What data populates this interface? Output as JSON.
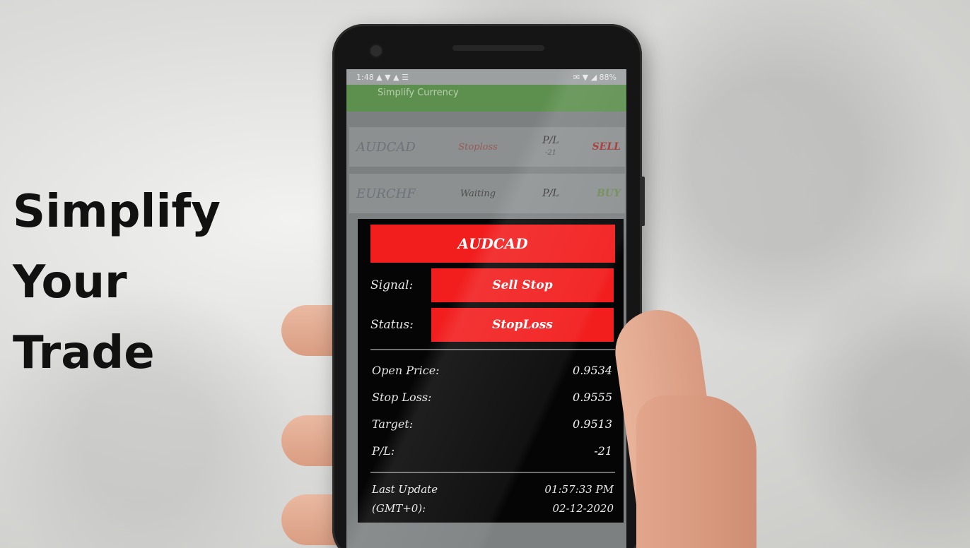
{
  "tagline": [
    "Simplify",
    "Your",
    "Trade"
  ],
  "statusbar": {
    "left": "1:48 ▲ ▼ ▲ ☰",
    "right": "✉ ▼ ◢ 88%"
  },
  "appbar": {
    "title": "Simplify Currency"
  },
  "list": [
    {
      "pair": "AUDCAD",
      "status": "Stoploss",
      "pl_label": "P/L",
      "pl_value": "-21",
      "signal": "SELL"
    },
    {
      "pair": "EURCHF",
      "status": "Waiting",
      "pl_label": "P/L",
      "pl_value": "",
      "signal": "BUY"
    }
  ],
  "dialog": {
    "pair": "AUDCAD",
    "signal_label": "Signal:",
    "signal_value": "Sell Stop",
    "status_label": "Status:",
    "status_value": "StopLoss",
    "open_price_label": "Open Price:",
    "open_price_value": "0.9534",
    "stop_loss_label": "Stop Loss:",
    "stop_loss_value": "0.9555",
    "target_label": "Target:",
    "target_value": "0.9513",
    "pl_label": "P/L:",
    "pl_value": "-21",
    "last_update_label_1": "Last Update",
    "last_update_label_2": "(GMT+0):",
    "last_update_time": "01:57:33 PM",
    "last_update_date": "02-12-2020"
  },
  "colors": {
    "accent_red": "#f21d1d",
    "appbar_green": "#5d8f4e",
    "dialog_bg": "#050505"
  }
}
